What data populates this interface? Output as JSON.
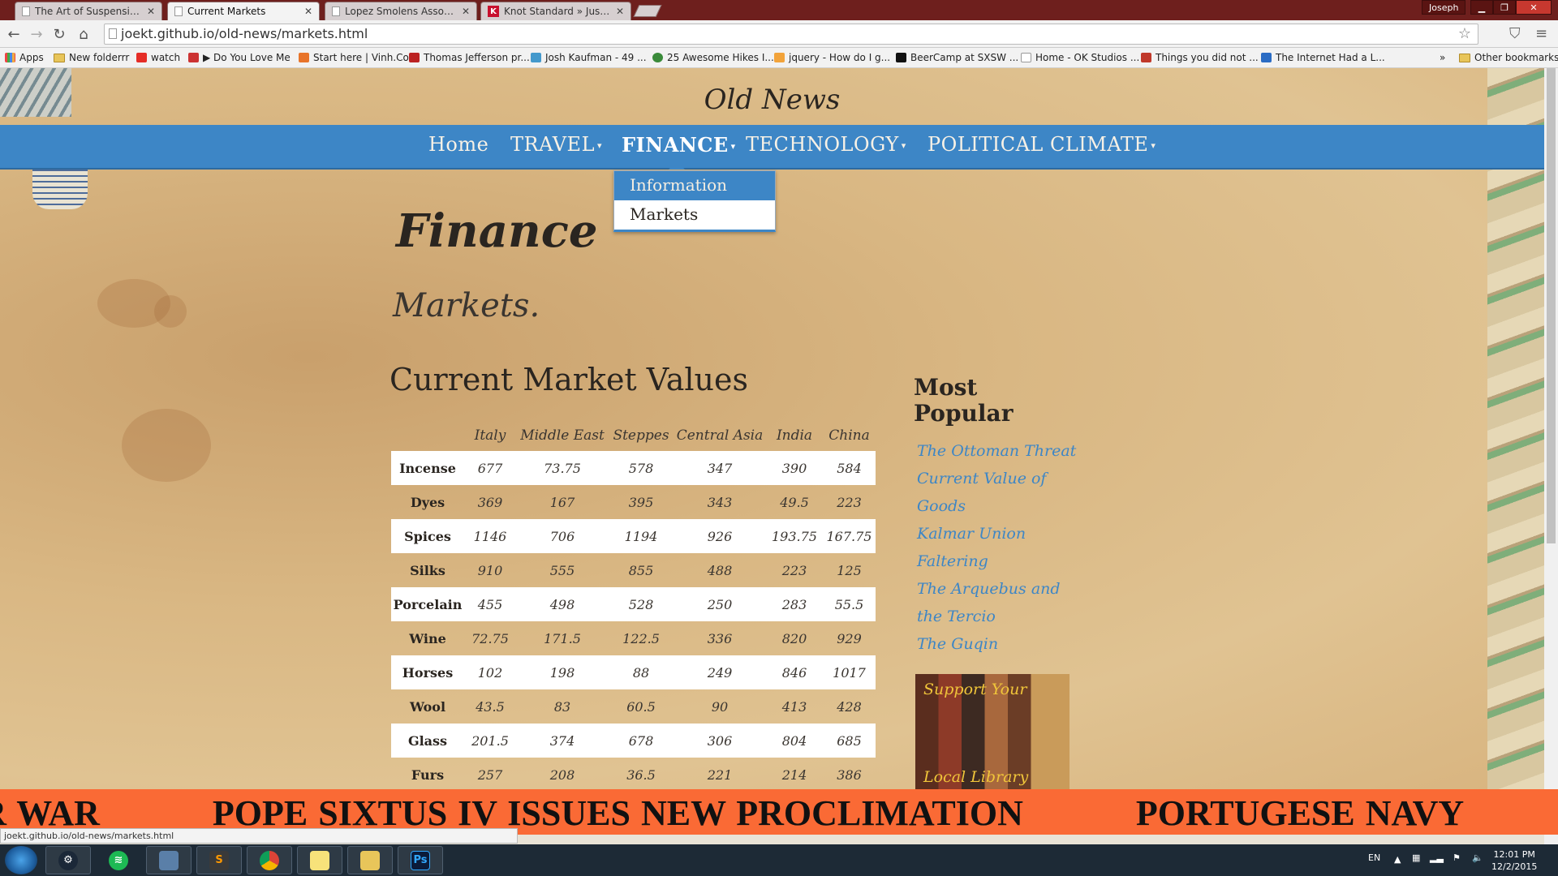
{
  "browser": {
    "tabs": [
      {
        "title": "The Art of Suspension of I",
        "active": false
      },
      {
        "title": "Current Markets",
        "active": true
      },
      {
        "title": "Lopez Smolens Associates",
        "active": false
      },
      {
        "title": "Knot Standard » Just anot",
        "active": false
      }
    ],
    "profile": "Joseph",
    "url": "joekt.github.io/old-news/markets.html",
    "bookmarks": [
      "Apps",
      "New folderrr",
      "watch",
      "▶ Do You Love Me",
      "Start here | Vinh.Co",
      "Thomas Jefferson pr...",
      "Josh Kaufman - 49 ...",
      "25 Awesome Hikes I...",
      "jquery - How do I g...",
      "BeerCamp at SXSW ...",
      "Home - OK Studios ...",
      "Things you did not ...",
      "The Internet Had a L..."
    ],
    "bookmarks_overflow": "»",
    "other_bookmarks": "Other bookmarks",
    "status_url": "joekt.github.io/old-news/markets.html"
  },
  "site": {
    "title": "Old News",
    "nav": [
      {
        "label": "Home",
        "caret": ""
      },
      {
        "label": "TRAVEL",
        "caret": "▾"
      },
      {
        "label": "FINANCE",
        "caret": "▾"
      },
      {
        "label": "TECHNOLOGY",
        "caret": "▾"
      },
      {
        "label": "POLITICAL CLIMATE",
        "caret": "▾"
      }
    ],
    "dropdown": [
      "Information",
      "Markets"
    ]
  },
  "page": {
    "heading": "Finance",
    "subheading": "Markets.",
    "section_title": "Current Market Values"
  },
  "table": {
    "columns": [
      "",
      "Italy",
      "Middle East",
      "Steppes",
      "Central Asia",
      "India",
      "China"
    ],
    "rows": [
      {
        "label": "Incense",
        "values": [
          "677",
          "73.75",
          "578",
          "347",
          "390",
          "584"
        ]
      },
      {
        "label": "Dyes",
        "values": [
          "369",
          "167",
          "395",
          "343",
          "49.5",
          "223"
        ]
      },
      {
        "label": "Spices",
        "values": [
          "1146",
          "706",
          "1194",
          "926",
          "193.75",
          "167.75"
        ]
      },
      {
        "label": "Silks",
        "values": [
          "910",
          "555",
          "855",
          "488",
          "223",
          "125"
        ]
      },
      {
        "label": "Porcelain",
        "values": [
          "455",
          "498",
          "528",
          "250",
          "283",
          "55.5"
        ]
      },
      {
        "label": "Wine",
        "values": [
          "72.75",
          "171.5",
          "122.5",
          "336",
          "820",
          "929"
        ]
      },
      {
        "label": "Horses",
        "values": [
          "102",
          "198",
          "88",
          "249",
          "846",
          "1017"
        ]
      },
      {
        "label": "Wool",
        "values": [
          "43.5",
          "83",
          "60.5",
          "90",
          "413",
          "428"
        ]
      },
      {
        "label": "Glass",
        "values": [
          "201.5",
          "374",
          "678",
          "306",
          "804",
          "685"
        ]
      },
      {
        "label": "Furs",
        "values": [
          "257",
          "208",
          "36.5",
          "221",
          "214",
          "386"
        ]
      }
    ]
  },
  "sidebar": {
    "heading_line1": "Most",
    "heading_line2": "Popular",
    "links": [
      "The Ottoman Threat",
      "Current Value of Goods",
      "Kalmar Union Faltering",
      "The Arquebus and the Tercio",
      "The Guqin"
    ],
    "ad_top": "Support Your",
    "ad_bottom": "Local Library"
  },
  "ticker": {
    "items": [
      "OR WAR",
      "POPE SIXTUS IV ISSUES NEW PROCLIMATION",
      "PORTUGESE NAVY"
    ]
  },
  "taskbar": {
    "language": "EN",
    "time": "12:01 PM",
    "date": "12/2/2015"
  }
}
